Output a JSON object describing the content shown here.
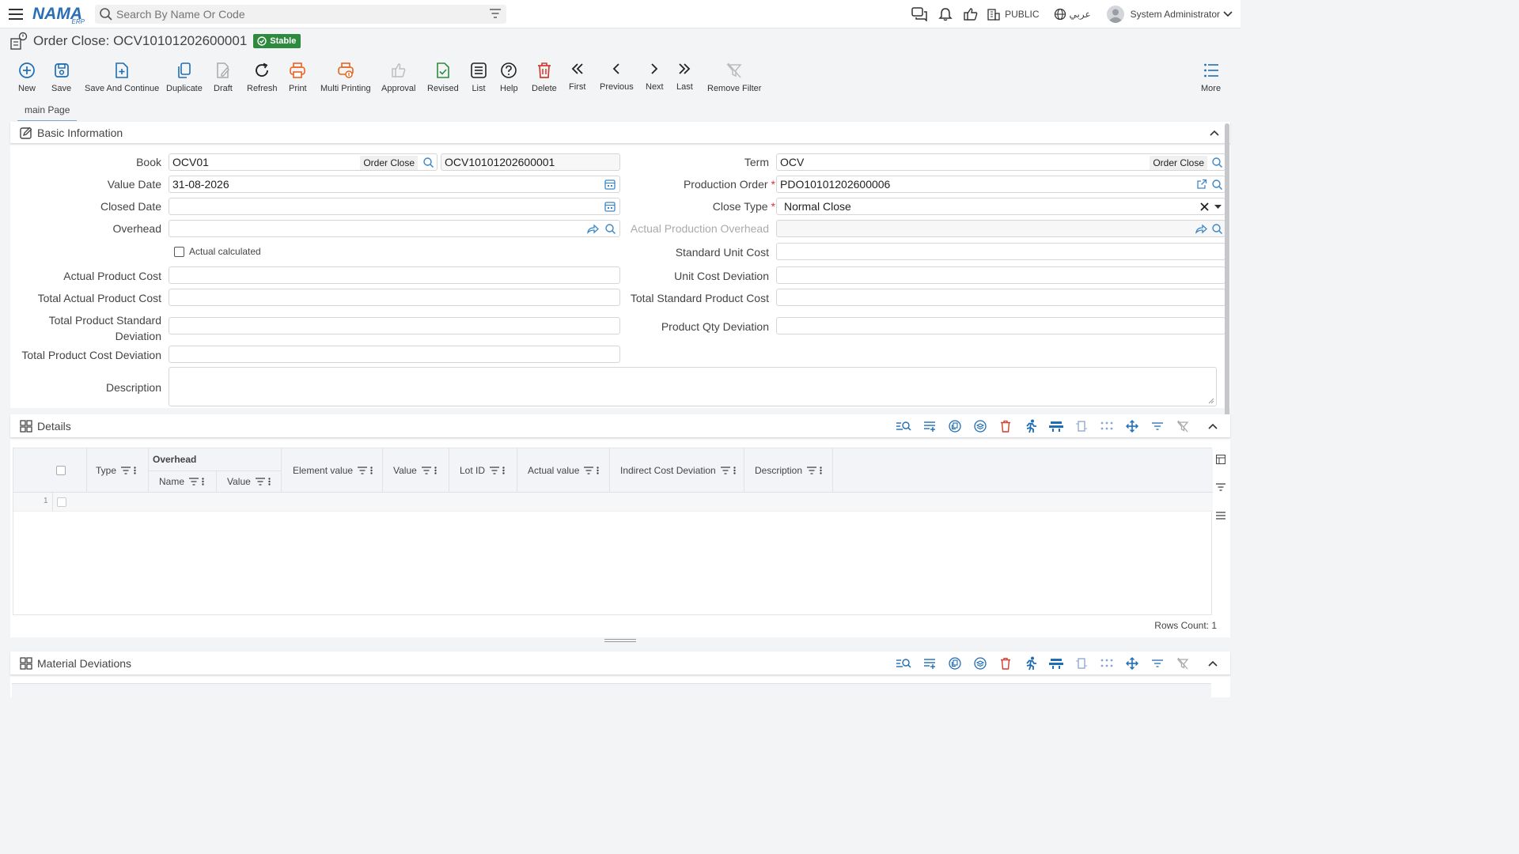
{
  "app": {
    "logo": "NAMA",
    "logo_sub": "ERP"
  },
  "search": {
    "placeholder": "Search By Name Or Code"
  },
  "header": {
    "public_label": "PUBLIC",
    "language_label": "عربي",
    "user_name": "System Administrator"
  },
  "page": {
    "title": "Order Close: OCV10101202600001",
    "status": "Stable"
  },
  "toolbar": [
    {
      "label": "New"
    },
    {
      "label": "Save"
    },
    {
      "label": "Save And Continue"
    },
    {
      "label": "Duplicate"
    },
    {
      "label": "Draft"
    },
    {
      "label": "Refresh"
    },
    {
      "label": "Print"
    },
    {
      "label": "Multi Printing"
    },
    {
      "label": "Approval"
    },
    {
      "label": "Revised"
    },
    {
      "label": "List"
    },
    {
      "label": "Help"
    },
    {
      "label": "Delete"
    },
    {
      "label": "First"
    },
    {
      "label": "Previous"
    },
    {
      "label": "Next"
    },
    {
      "label": "Last"
    },
    {
      "label": "Remove Filter"
    },
    {
      "label": "More"
    }
  ],
  "tabs": [
    {
      "label": "main Page"
    }
  ],
  "basic": {
    "title": "Basic Information",
    "book_label": "Book",
    "book_value": "OCV01",
    "book_tag": "Order Close",
    "book_code": "OCV10101202600001",
    "term_label": "Term",
    "term_value": "OCV",
    "term_tag": "Order Close",
    "value_date_label": "Value Date",
    "value_date": "31-08-2026",
    "production_order_label": "Production Order",
    "production_order": "PDO10101202600006",
    "closed_date_label": "Closed Date",
    "closed_date": "",
    "close_type_label": "Close Type",
    "close_type": "Normal Close",
    "overhead_label": "Overhead",
    "overhead": "",
    "actual_prod_overhead_label": "Actual Production Overhead",
    "actual_calculated_label": "Actual calculated",
    "standard_unit_cost_label": "Standard Unit Cost",
    "actual_product_cost_label": "Actual Product Cost",
    "unit_cost_deviation_label": "Unit Cost Deviation",
    "total_actual_product_cost_label": "Total Actual Product Cost",
    "total_standard_product_cost_label": "Total Standard Product Cost",
    "total_product_standard_deviation_label_1": "Total Product Standard",
    "total_product_standard_deviation_label_2": "Deviation",
    "product_qty_deviation_label": "Product Qty Deviation",
    "total_product_cost_deviation_label": "Total Product Cost Deviation",
    "description_label": "Description"
  },
  "details": {
    "title": "Details",
    "columns": {
      "type": "Type",
      "overhead_group": "Overhead",
      "name": "Name",
      "value": "Value",
      "element_value": "Element value",
      "value2": "Value",
      "lot_id": "Lot ID",
      "actual_value": "Actual value",
      "indirect_cost_deviation": "Indirect Cost Deviation",
      "description": "Description"
    },
    "row_number": "1",
    "rows_count": "Rows Count: 1"
  },
  "material": {
    "title": "Material Deviations"
  }
}
